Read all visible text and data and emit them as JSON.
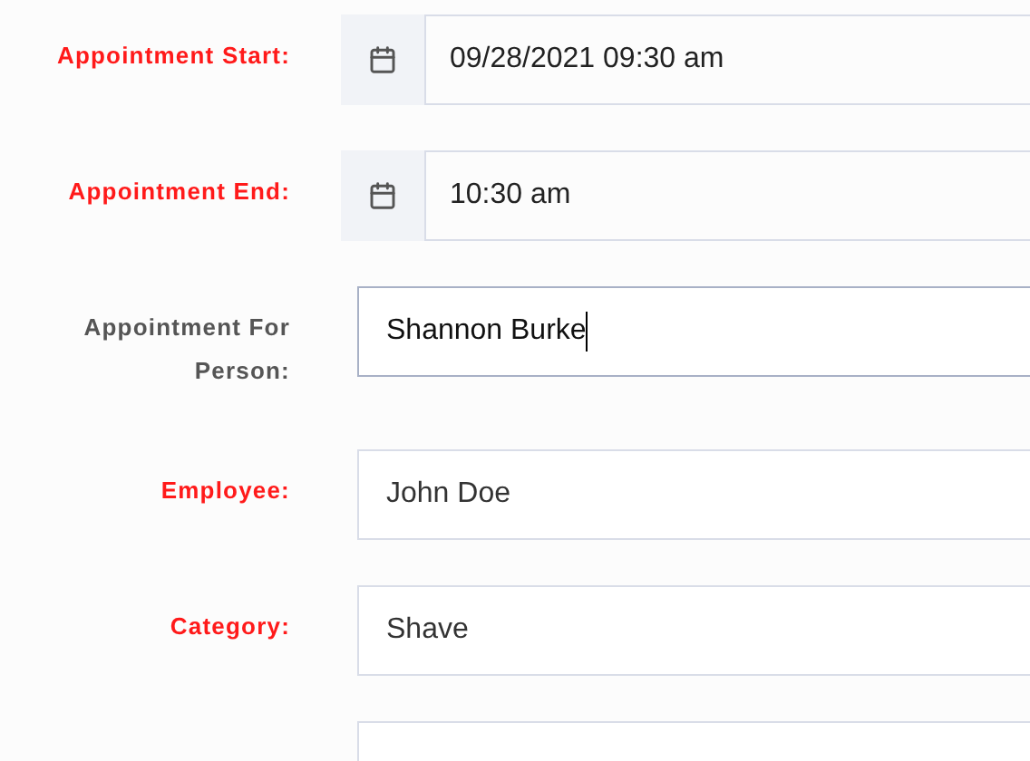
{
  "fields": [
    {
      "kind": "date",
      "label": "Appointment Start:",
      "required": true,
      "value": "09/28/2021 09:30 am",
      "focused": false
    },
    {
      "kind": "date",
      "label": "Appointment End:",
      "required": true,
      "value": "10:30 am",
      "focused": false
    },
    {
      "kind": "text",
      "label": "Appointment For Person:",
      "required": false,
      "value": "Shannon Burke",
      "focused": true
    },
    {
      "kind": "text",
      "label": "Employee:",
      "required": true,
      "value": "John Doe",
      "focused": false
    },
    {
      "kind": "text",
      "label": "Category:",
      "required": true,
      "value": "Shave",
      "focused": false
    },
    {
      "kind": "text",
      "focused": false
    }
  ]
}
